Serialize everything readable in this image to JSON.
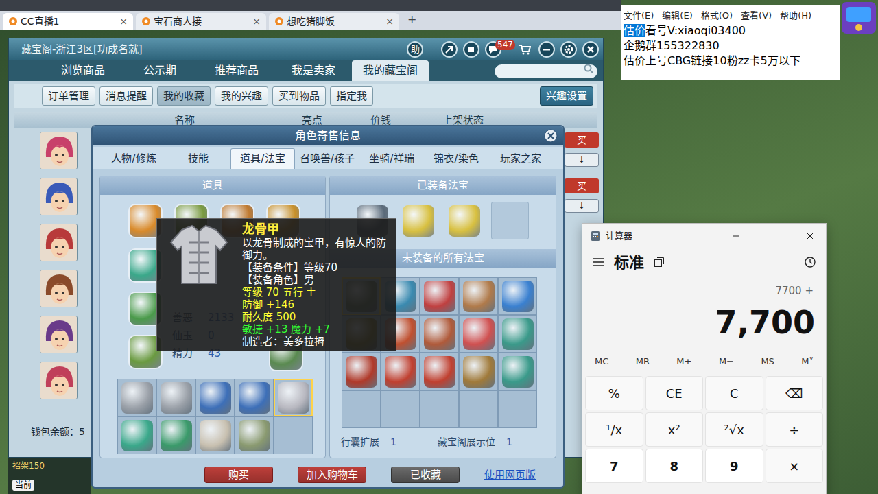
{
  "browser": {
    "tabs": [
      {
        "label": "CC直播1",
        "selected": true
      },
      {
        "label": "宝石商人接",
        "selected": false
      },
      {
        "label": "想吃猪脚饭",
        "selected": false
      }
    ],
    "close": "×",
    "new_tab": "+"
  },
  "notepad": {
    "menu": [
      "文件(E)",
      "编辑(E)",
      "格式(O)",
      "查看(V)",
      "帮助(H)"
    ],
    "lines": [
      [
        {
          "text": "估价",
          "selected": true
        },
        {
          "text": "看号V:xiaoqi03400",
          "selected": false
        }
      ],
      [
        {
          "text": "企鹅群155322830",
          "selected": false
        }
      ],
      [
        {
          "text": "估价上号CBG链接10粉zz卡5万以下",
          "selected": false
        }
      ]
    ]
  },
  "game": {
    "title": "藏宝阁-浙江3区[功成名就]",
    "help": "助",
    "messages": "547",
    "nav_tabs": [
      {
        "label": "浏览商品",
        "selected": false
      },
      {
        "label": "公示期",
        "selected": false
      },
      {
        "label": "推荐商品",
        "selected": false
      },
      {
        "label": "我是卖家",
        "selected": false
      },
      {
        "label": "我的藏宝阁",
        "selected": true
      }
    ],
    "sub_tabs": [
      {
        "label": "订单管理",
        "selected": false
      },
      {
        "label": "消息提醒",
        "selected": false
      },
      {
        "label": "我的收藏",
        "selected": true
      },
      {
        "label": "我的兴趣",
        "selected": false
      },
      {
        "label": "买到物品",
        "selected": false
      },
      {
        "label": "指定我",
        "selected": false
      }
    ],
    "interest_button": "兴趣设置",
    "columns": [
      "名称",
      "亮点",
      "价钱",
      "上架状态"
    ],
    "avatars": [
      {
        "color": "#c8406a"
      },
      {
        "color": "#3a5ab8"
      },
      {
        "color": "#b83a3a"
      },
      {
        "color": "#8a4a2a"
      },
      {
        "color": "#6a3a8a"
      },
      {
        "color": "#c0405a"
      }
    ],
    "buy_rows": [
      {
        "buy": "买",
        "sort": "↓"
      },
      {
        "buy": "买",
        "sort": "↓"
      }
    ],
    "wallet": "钱包余额：5",
    "status": "招架150",
    "channel": "当前"
  },
  "dialog": {
    "title": "角色寄售信息",
    "tabs": [
      {
        "label": "人物/修炼",
        "selected": false
      },
      {
        "label": "技能",
        "selected": false
      },
      {
        "label": "道具/法宝",
        "selected": true
      },
      {
        "label": "召唤兽/孩子",
        "selected": false
      },
      {
        "label": "坐骑/祥瑞",
        "selected": false
      },
      {
        "label": "锦衣/染色",
        "selected": false
      },
      {
        "label": "玩家之家",
        "selected": false
      }
    ],
    "items_header": "道具",
    "equipped_top": [
      {
        "kind": "item",
        "color": "#d98a2a",
        "selected": false
      },
      {
        "kind": "item",
        "color": "#7a9a40",
        "selected": false
      },
      {
        "kind": "item",
        "color": "#c07a30",
        "selected": false
      },
      {
        "kind": "item",
        "color": "#c8902a",
        "selected": false
      }
    ],
    "equipped_left": [
      {
        "kind": "item",
        "color": "#3aa88a",
        "selected": false
      },
      {
        "kind": "item",
        "color": "#4a9a4a",
        "selected": false
      },
      {
        "kind": "item",
        "color": "#6a9a40",
        "selected": false
      }
    ],
    "equipped_right": [
      {
        "kind": "item",
        "color": "#5a8a50",
        "selected": false
      }
    ],
    "stats": [
      {
        "label": "善恶",
        "value": "2133"
      },
      {
        "label": "仙玉",
        "value": "0"
      },
      {
        "label": "精力",
        "value": "43"
      }
    ],
    "inventory": [
      {
        "kind": "item",
        "color": "#9aa0a8",
        "selected": false
      },
      {
        "kind": "item",
        "color": "#9aa0a8",
        "selected": false
      },
      {
        "kind": "item",
        "color": "#3d6fb8",
        "selected": false
      },
      {
        "kind": "item",
        "color": "#3d6fb8",
        "selected": false
      },
      {
        "kind": "item",
        "color": "#b8b8c0",
        "selected": true
      },
      {
        "kind": "item",
        "color": "#3aa88a",
        "selected": false
      },
      {
        "kind": "item",
        "color": "#3a9a6a",
        "selected": false
      },
      {
        "kind": "item",
        "color": "#c8c0b0",
        "selected": false
      },
      {
        "kind": "item",
        "color": "#8a9a70",
        "selected": false
      },
      {
        "kind": "empty",
        "selected": false
      }
    ],
    "equipped_fabao_header": "已装备法宝",
    "equipped_fabao": [
      {
        "kind": "item",
        "color": "#5a6a7a",
        "selected": false
      },
      {
        "kind": "item",
        "color": "#d8c040",
        "selected": false
      },
      {
        "kind": "item",
        "color": "#d8c040",
        "selected": false
      },
      {
        "kind": "empty",
        "selected": false
      }
    ],
    "unequipped_fabao_header": "未装备的所有法宝",
    "unequipped_fabao": [
      {
        "kind": "item",
        "color": "#6a7a5a",
        "selected": true
      },
      {
        "kind": "item",
        "color": "#3a8ab0",
        "selected": false
      },
      {
        "kind": "item",
        "color": "#c04040",
        "selected": false
      },
      {
        "kind": "item",
        "color": "#b07a4a",
        "selected": false
      },
      {
        "kind": "item",
        "color": "#3a80d0",
        "selected": false
      },
      {
        "kind": "item",
        "color": "#8a7a2a",
        "selected": false
      },
      {
        "kind": "item",
        "color": "#c05030",
        "selected": false
      },
      {
        "kind": "item",
        "color": "#b05a3a",
        "selected": false
      },
      {
        "kind": "item",
        "color": "#d05050",
        "selected": false
      },
      {
        "kind": "item",
        "color": "#3a9a8a",
        "selected": false
      },
      {
        "kind": "item",
        "color": "#b03a2a",
        "selected": false
      },
      {
        "kind": "item",
        "color": "#c04030",
        "selected": false
      },
      {
        "kind": "item",
        "color": "#c04030",
        "selected": false
      },
      {
        "kind": "item",
        "color": "#a07a3a",
        "selected": false
      },
      {
        "kind": "item",
        "color": "#3a9a8a",
        "selected": false
      },
      {
        "kind": "empty",
        "selected": false
      },
      {
        "kind": "empty",
        "selected": false
      },
      {
        "kind": "empty",
        "selected": false
      },
      {
        "kind": "empty",
        "selected": false
      },
      {
        "kind": "empty",
        "selected": false
      }
    ],
    "footer": [
      {
        "label": "行囊扩展",
        "value": "1"
      },
      {
        "label": "藏宝阁展示位",
        "value": "1"
      }
    ],
    "buttons": [
      {
        "label": "购买",
        "kind": "red"
      },
      {
        "label": "加入购物车",
        "kind": "red"
      },
      {
        "label": "已收藏",
        "kind": "grey"
      },
      {
        "label": "使用网页版",
        "kind": "link"
      }
    ]
  },
  "tooltip": {
    "name": "龙骨甲",
    "lines": [
      {
        "text": "以龙骨制成的宝甲，有惊人的防御力。",
        "color": "#ffffff"
      },
      {
        "text": "【装备条件】等级70",
        "color": "#ffffff"
      },
      {
        "text": "【装备角色】男",
        "color": "#ffffff"
      },
      {
        "text": "等级 70  五行 土",
        "color": "#ffff33"
      },
      {
        "text": "防御 +146",
        "color": "#ffff33"
      },
      {
        "text": "耐久度 500",
        "color": "#ffff33"
      },
      {
        "text": "敏捷 +13 魔力 +7",
        "color": "#33ff33"
      },
      {
        "text": "制造者：美多拉拇",
        "color": "#ffffff"
      }
    ]
  },
  "calculator": {
    "title": "计算器",
    "mode": "标准",
    "history": "7700 +",
    "display": "7,700",
    "memory": [
      "MC",
      "MR",
      "M+",
      "M−",
      "MS",
      "M˅"
    ],
    "keys": [
      {
        "label": "%",
        "kind": "op"
      },
      {
        "label": "CE",
        "kind": "op"
      },
      {
        "label": "C",
        "kind": "op"
      },
      {
        "label": "⌫",
        "kind": "op"
      },
      {
        "label": "¹/x",
        "kind": "op"
      },
      {
        "label": "x²",
        "kind": "op"
      },
      {
        "label": "²√x",
        "kind": "op"
      },
      {
        "label": "÷",
        "kind": "op"
      },
      {
        "label": "7",
        "kind": "num"
      },
      {
        "label": "8",
        "kind": "num"
      },
      {
        "label": "9",
        "kind": "num"
      },
      {
        "label": "×",
        "kind": "op"
      }
    ]
  }
}
